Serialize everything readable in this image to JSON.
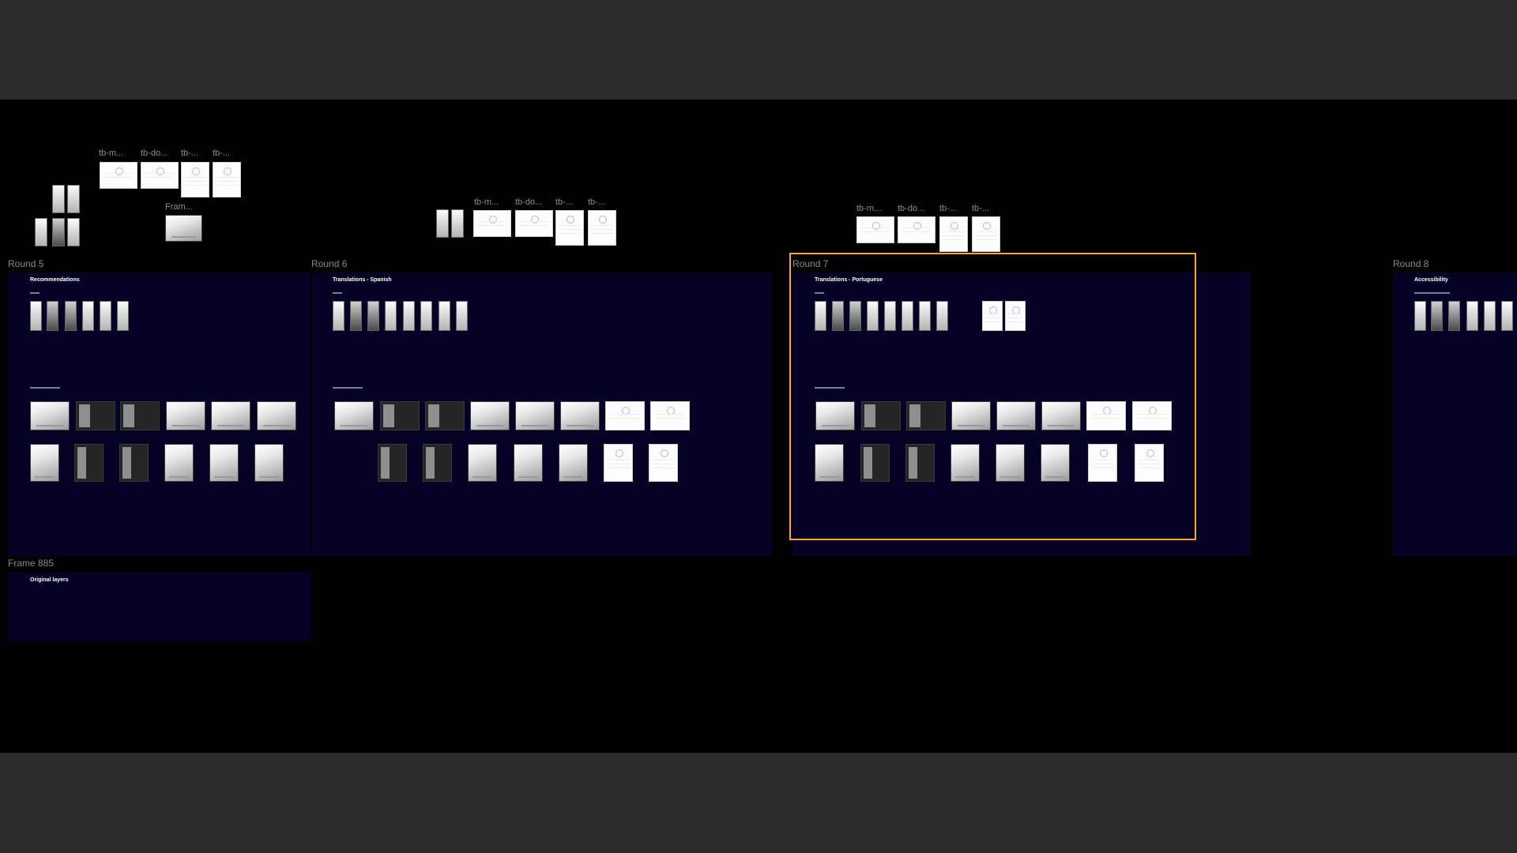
{
  "canvas": {
    "frames": {
      "round5": "Round 5",
      "round6": "Round 6",
      "round7": "Round 7",
      "round8": "Round 8",
      "frame885": "Frame 885"
    },
    "sections": {
      "recommendations": "Recommendations",
      "spanish": "Translations - Spanish",
      "portuguese": "Translations - Portuguese",
      "accessibility": "Accessibility",
      "original_layers": "Original layers"
    },
    "thumbnail_labels": {
      "tb_m": "tb-m...",
      "tb_do": "tb-do...",
      "tb_short": "tb-...",
      "fram": "Fram..."
    }
  }
}
